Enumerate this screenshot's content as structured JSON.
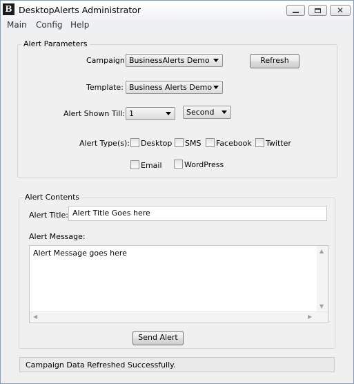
{
  "window": {
    "icon_glyph": "B",
    "title": "DesktopAlerts Administrator",
    "controls": {
      "minimize": "minimize-icon",
      "maximize": "maximize-icon",
      "close": "close-icon"
    }
  },
  "menu": [
    "Main",
    "Config",
    "Help"
  ],
  "params": {
    "group_title": "Alert Parameters",
    "campaign_label": "Campaign:",
    "campaign_value": "BusinessAlerts Demo",
    "refresh_label": "Refresh",
    "template_label": "Template:",
    "template_value": "Business Alerts Demo",
    "shown_till_label": "Alert Shown Till:",
    "shown_till_value": "1",
    "shown_till_unit": "Second",
    "types_label": "Alert Type(s):",
    "types": [
      {
        "label": "Desktop",
        "checked": false
      },
      {
        "label": "SMS",
        "checked": false
      },
      {
        "label": "Facebook",
        "checked": false
      },
      {
        "label": "Twitter",
        "checked": false
      },
      {
        "label": "Email",
        "checked": false
      },
      {
        "label": "WordPress",
        "checked": false
      }
    ]
  },
  "contents": {
    "group_title": "Alert Contents",
    "title_label": "Alert Title:",
    "title_value": "Alert Title Goes here",
    "message_label": "Alert Message:",
    "message_value": "Alert Message goes here",
    "send_label": "Send Alert"
  },
  "status": "Campaign Data Refreshed Successfully."
}
